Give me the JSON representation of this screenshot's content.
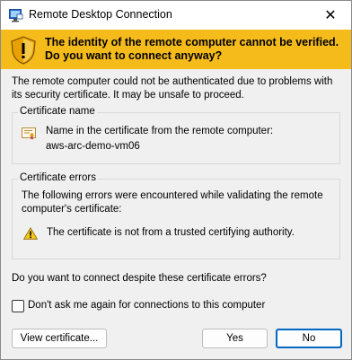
{
  "window": {
    "title": "Remote Desktop Connection",
    "close_glyph": "✕"
  },
  "banner": {
    "text": "The identity of the remote computer cannot be verified. Do you want to connect anyway?"
  },
  "intro_text": "The remote computer could not be authenticated due to problems with its security certificate. It may be unsafe to proceed.",
  "certificate_name": {
    "label": "Certificate name",
    "line1": "Name in the certificate from the remote computer:",
    "line2": "aws-arc-demo-vm06"
  },
  "certificate_errors": {
    "label": "Certificate errors",
    "description": "The following errors were encountered while validating the remote computer's certificate:",
    "error": "The certificate is not from a trusted certifying authority."
  },
  "question": "Do you want to connect despite these certificate errors?",
  "dont_ask": {
    "label": "Don't ask me again for connections to this computer",
    "checked": false
  },
  "buttons": {
    "view_certificate": "View certificate...",
    "yes": "Yes",
    "no": "No"
  },
  "colors": {
    "banner": "#f5bb1b",
    "primary_border": "#0067c0"
  }
}
